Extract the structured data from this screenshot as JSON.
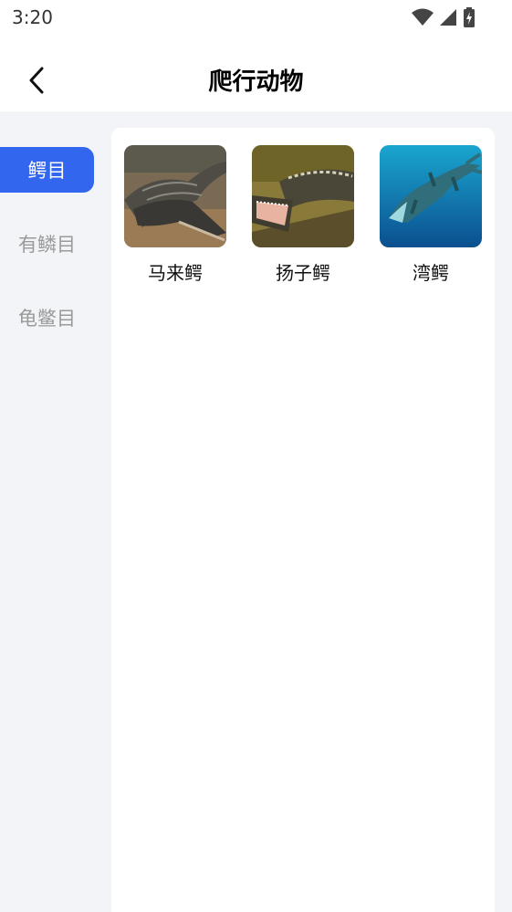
{
  "status_bar": {
    "time": "3:20",
    "icons": [
      "wifi-icon",
      "signal-icon",
      "battery-charging-icon"
    ]
  },
  "header": {
    "title": "爬行动物",
    "back_icon": "chevron-left-icon"
  },
  "sidebar": {
    "items": [
      {
        "label": "鳄目",
        "active": true
      },
      {
        "label": "有鳞目",
        "active": false
      },
      {
        "label": "龟鳖目",
        "active": false
      }
    ],
    "active_color": "#3366ee",
    "inactive_text_color": "#9a9a9a"
  },
  "grid": {
    "items": [
      {
        "label": "马来鳄",
        "image": "malayan-gharial-photo"
      },
      {
        "label": "扬子鳄",
        "image": "chinese-alligator-photo"
      },
      {
        "label": "湾鳄",
        "image": "saltwater-crocodile-photo"
      }
    ]
  },
  "colors": {
    "background": "#f3f4f7",
    "panel": "#ffffff",
    "accent": "#3366ee"
  }
}
